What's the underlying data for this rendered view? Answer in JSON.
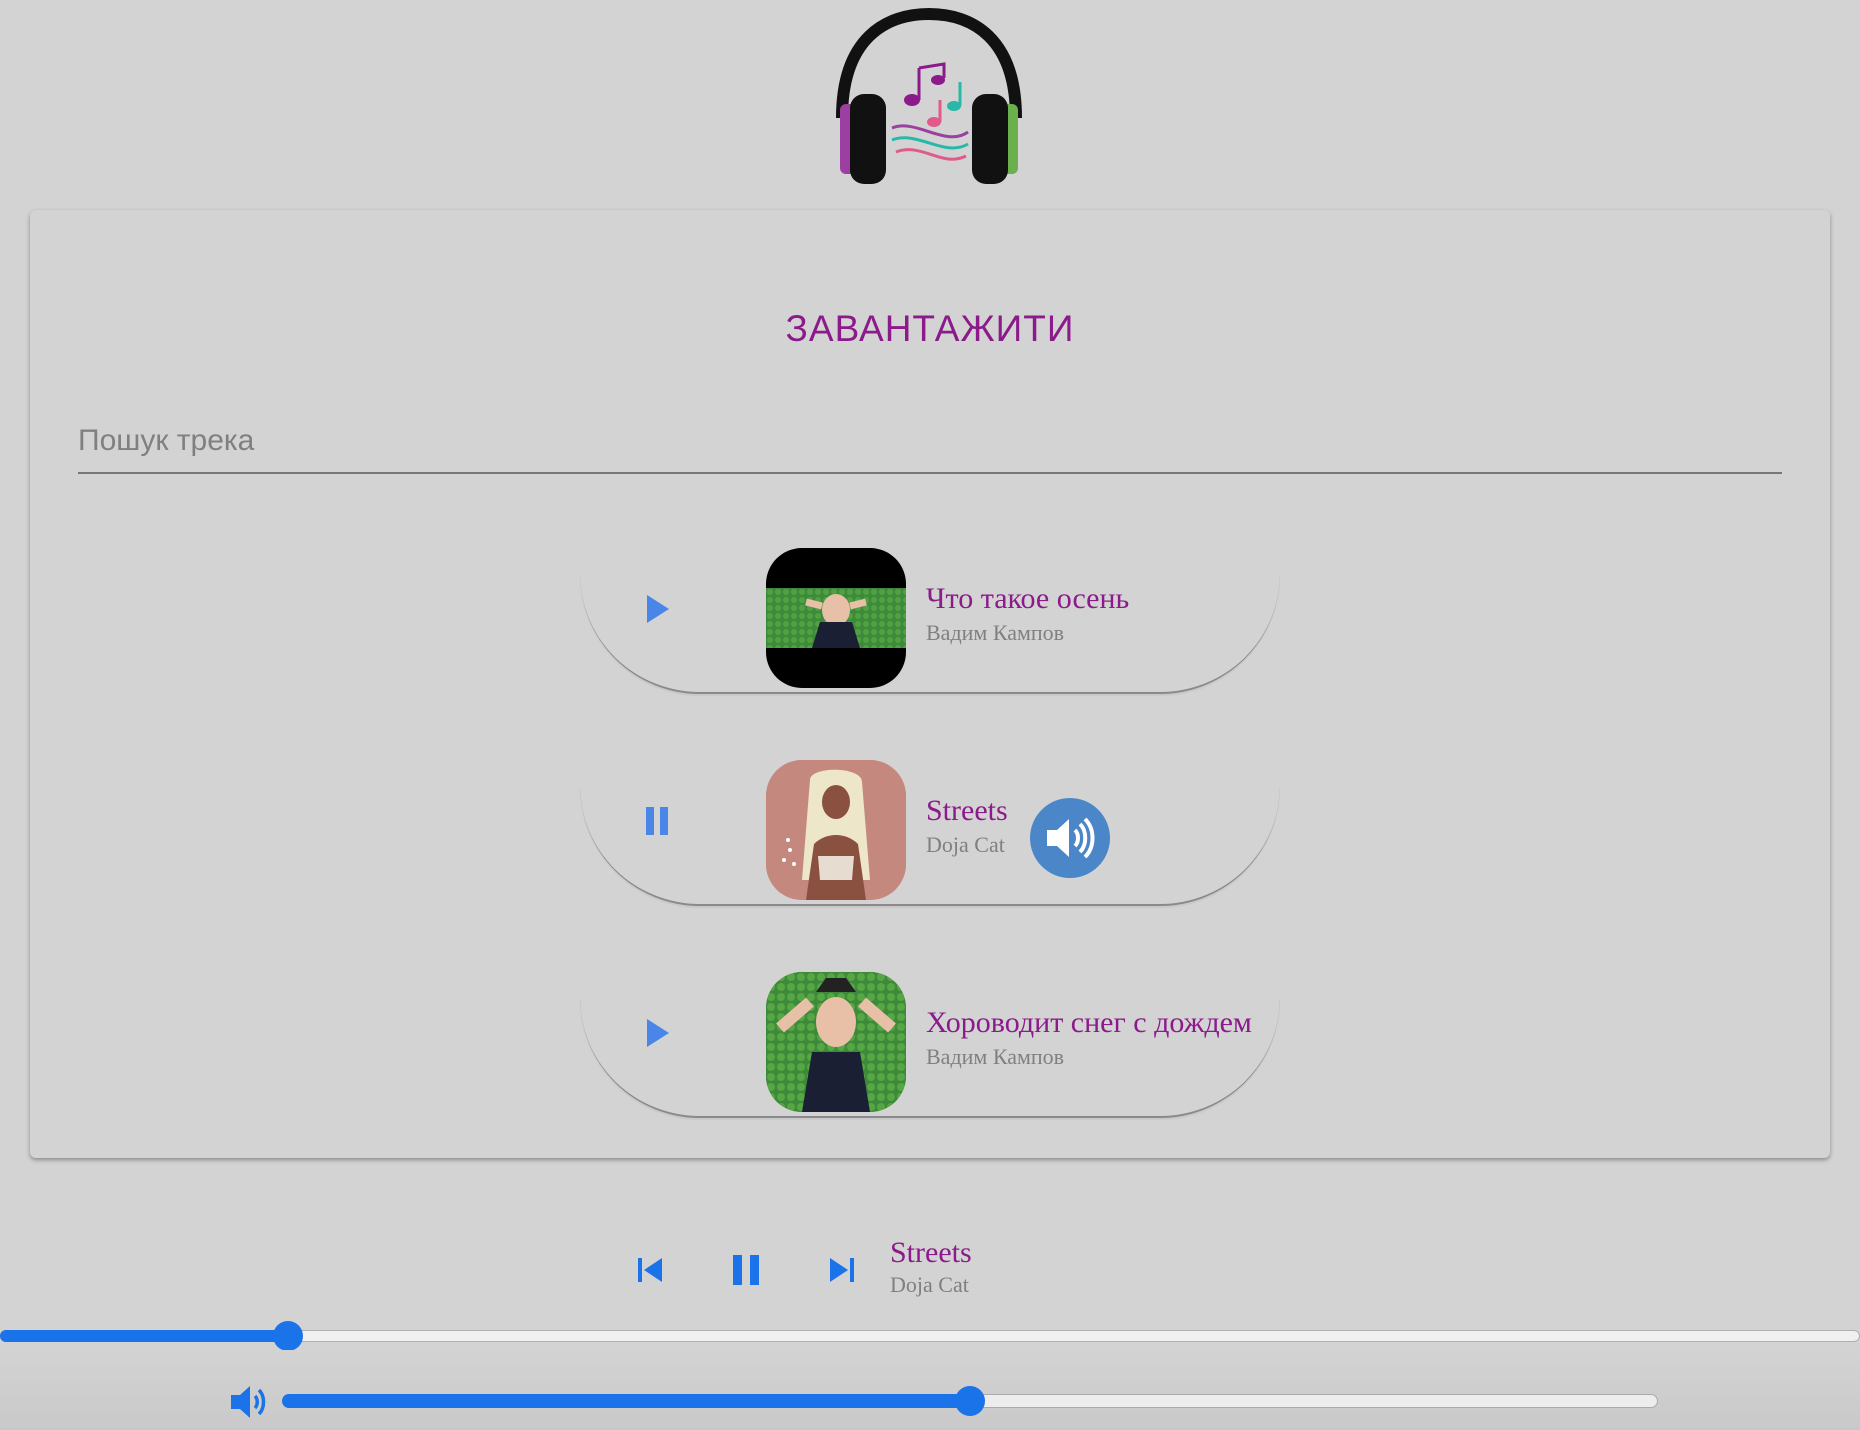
{
  "header": {
    "logo_icon": "headphones-music-notes-logo"
  },
  "upload": {
    "label": "ЗАВАНТАЖИТИ"
  },
  "search": {
    "placeholder": "Пошук трека",
    "value": ""
  },
  "tracks": [
    {
      "title": "Что такое осень",
      "artist": "Вадим Кампов",
      "state": "paused",
      "control_icon": "play-icon",
      "cover": "man-lying-on-grass-letterboxed"
    },
    {
      "title": "Streets",
      "artist": "Doja Cat",
      "state": "playing",
      "control_icon": "pause-icon",
      "cover": "blonde-woman-portrait",
      "indicator_icon": "speaker-icon"
    },
    {
      "title": "Хороводит снег с дождем",
      "artist": "Вадим Кампов",
      "state": "paused",
      "control_icon": "play-icon",
      "cover": "man-lying-on-grass"
    }
  ],
  "player": {
    "now_playing": {
      "title": "Streets",
      "artist": "Doja Cat"
    },
    "buttons": [
      "previous-track-icon",
      "pause-icon",
      "next-track-icon"
    ],
    "progress": 0.155,
    "volume": 0.5
  },
  "colors": {
    "background": "#d3d3d3",
    "accent_purple": "#8b1a8b",
    "accent_blue": "#1a73e8",
    "control_blue": "#4a86e8",
    "secondary_text": "#808080"
  }
}
